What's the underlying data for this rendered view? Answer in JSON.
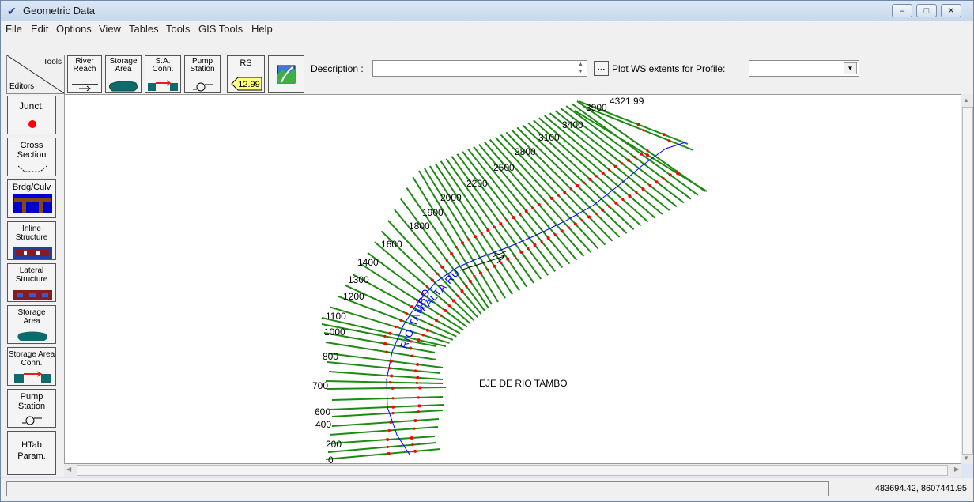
{
  "window": {
    "title": "Geometric Data"
  },
  "menu": [
    "File",
    "Edit",
    "Options",
    "View",
    "Tables",
    "Tools",
    "GIS Tools",
    "Help"
  ],
  "toolbar": {
    "tools_label": "Tools",
    "editors_label": "Editors",
    "river_reach": "River Reach",
    "storage_area": "Storage Area",
    "sa_conn": "S.A. Conn.",
    "pump_station": "Pump Station",
    "rs_label": "RS",
    "rs_value": "12.99",
    "description_label": "Description :",
    "description_value": "",
    "dots_label": "...",
    "plot_ws_label": "Plot WS extents for Profile:",
    "profile_value": ""
  },
  "sidebar": [
    "Junct.",
    "Cross Section",
    "Brdg/Culv",
    "Inline Structure",
    "Lateral Structure",
    "Storage Area",
    "Storage Area Conn.",
    "Pump Station",
    "HTab Param."
  ],
  "map": {
    "river_label": "RIO TAMBO",
    "reach_label": "PALTA RU",
    "annotation": "EJE DE RIO TAMBO",
    "station_labels": [
      "4321.99",
      "3900",
      "3400",
      "3100",
      "2800",
      "2500",
      "2200",
      "2000",
      "1900",
      "1800",
      "1600",
      "1400",
      "1300",
      "1200",
      "1100",
      "1000",
      "800",
      "700",
      "600",
      "400",
      "200",
      "0"
    ],
    "colors": {
      "cross_section": "#1e8a14",
      "river": "#0000ff",
      "bank": "#ff0000"
    }
  },
  "status": {
    "coords": "483694.42, 8607441.95"
  }
}
